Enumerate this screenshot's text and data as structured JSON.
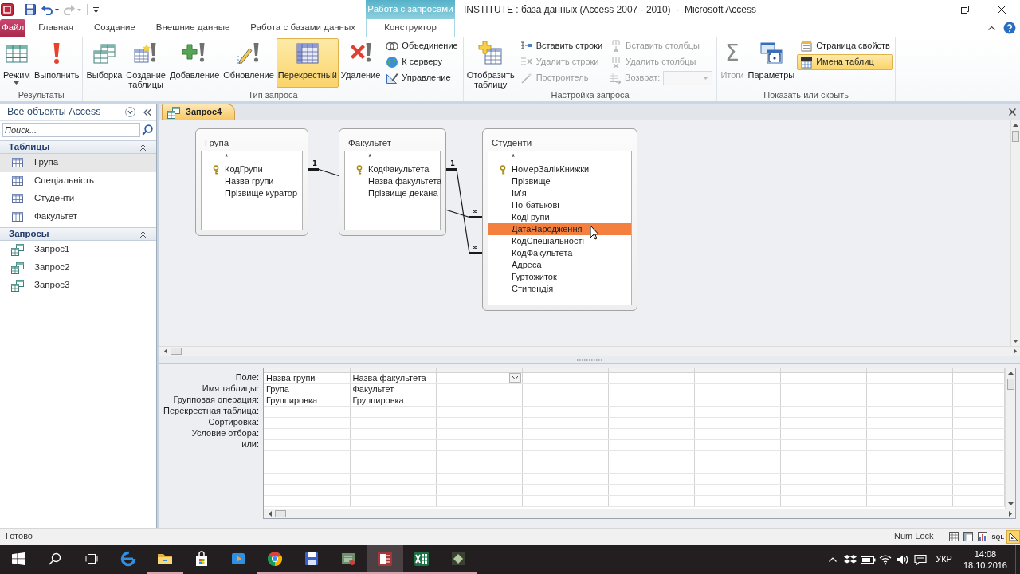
{
  "window": {
    "title": "INSTITUTE : база данных (Access 2007 - 2010)  -  Microsoft Access",
    "tab_group": "Работа с запросами"
  },
  "quick_access": [
    {
      "disabled": false
    },
    {
      "disabled": false
    },
    {
      "disabled": true
    }
  ],
  "ribbon_tabs": [
    {
      "label": "Файл",
      "kind": "file",
      "selected": false
    },
    {
      "label": "Главная",
      "kind": "plain",
      "selected": false
    },
    {
      "label": "Создание",
      "kind": "plain",
      "selected": false
    },
    {
      "label": "Внешние данные",
      "kind": "plain",
      "selected": false
    },
    {
      "label": "Работа с базами данных",
      "kind": "plain",
      "selected": false
    },
    {
      "label": "Конструктор",
      "kind": "context",
      "selected": true
    }
  ],
  "ribbon_groups": [
    {
      "label": "Результаты",
      "columns": [
        [
          {
            "kind": "large-menu",
            "label": "Режим",
            "disabled": false
          }
        ],
        [
          {
            "kind": "large",
            "label": "Выполнить",
            "disabled": false
          }
        ]
      ]
    },
    {
      "label": "Тип запроса",
      "columns": [
        [
          {
            "kind": "large",
            "label": "Выборка",
            "disabled": false,
            "selected": false
          }
        ],
        [
          {
            "kind": "large",
            "label": "Создание таблицы",
            "disabled": false,
            "selected": false
          }
        ],
        [
          {
            "kind": "large",
            "label": "Добавление",
            "disabled": false,
            "selected": false
          }
        ],
        [
          {
            "kind": "large",
            "label": "Обновление",
            "disabled": false,
            "selected": false
          }
        ],
        [
          {
            "kind": "large",
            "label": "Перекрестный",
            "disabled": false,
            "selected": true
          }
        ],
        [
          {
            "kind": "large",
            "label": "Удаление",
            "disabled": false,
            "selected": false
          }
        ],
        [
          {
            "kind": "small",
            "label": "Объединение",
            "disabled": false,
            "selected": false
          },
          {
            "kind": "small",
            "label": "К серверу",
            "disabled": false,
            "selected": false
          },
          {
            "kind": "small",
            "label": "Управление",
            "disabled": false,
            "selected": false
          }
        ]
      ]
    },
    {
      "label": "Настройка запроса",
      "columns": [
        [
          {
            "kind": "large",
            "label": "Отобразить таблицу",
            "disabled": false
          }
        ],
        [
          {
            "kind": "small",
            "label": "Вставить строки",
            "disabled": false
          },
          {
            "kind": "small",
            "label": "Удалить строки",
            "disabled": true
          },
          {
            "kind": "small",
            "label": "Построитель",
            "disabled": true
          }
        ],
        [
          {
            "kind": "small",
            "label": "Вставить столбцы",
            "disabled": true
          },
          {
            "kind": "small",
            "label": "Удалить столбцы",
            "disabled": true
          },
          {
            "kind": "combo",
            "label": "Возврат:",
            "disabled": true
          }
        ]
      ]
    },
    {
      "label": "Показать или скрыть",
      "columns": [
        [
          {
            "kind": "large",
            "label": "Итоги",
            "symbol": "Σ",
            "disabled": true
          }
        ],
        [
          {
            "kind": "large",
            "label": "Параметры",
            "disabled": false
          }
        ],
        [
          {
            "kind": "small",
            "label": "Страница свойств",
            "disabled": false,
            "on": false
          },
          {
            "kind": "small",
            "label": "Имена таблиц",
            "disabled": false,
            "on": true
          }
        ]
      ]
    }
  ],
  "nav_pane": {
    "title": "Все объекты Access",
    "search": {
      "placeholder": "Поиск..."
    },
    "groups": [
      {
        "label": "Таблицы",
        "expanded": true,
        "items": [
          {
            "label": "Група",
            "kind": "table",
            "selected": true
          },
          {
            "label": "Спеціальність",
            "kind": "table",
            "selected": false
          },
          {
            "label": "Студенти",
            "kind": "table",
            "selected": false
          },
          {
            "label": "Факультет",
            "kind": "table",
            "selected": false
          }
        ]
      },
      {
        "label": "Запросы",
        "expanded": true,
        "items": [
          {
            "label": "Запрос1",
            "kind": "query",
            "selected": false
          },
          {
            "label": "Запрос2",
            "kind": "query",
            "selected": false
          },
          {
            "label": "Запрос3",
            "kind": "query",
            "selected": false
          }
        ]
      }
    ]
  },
  "document_tabs": [
    {
      "label": "Запрос4",
      "selected": true
    }
  ],
  "query_design": {
    "tables": [
      {
        "title": "Група",
        "fields": [
          {
            "name": "*",
            "key": false,
            "selected": false
          },
          {
            "name": "КодГрупи",
            "key": true,
            "selected": false
          },
          {
            "name": "Назва групи",
            "key": false,
            "selected": false
          },
          {
            "name": "Прізвище куратор",
            "key": false,
            "selected": false
          }
        ]
      },
      {
        "title": "Факультет",
        "fields": [
          {
            "name": "*",
            "key": false,
            "selected": false
          },
          {
            "name": "КодФакультета",
            "key": true,
            "selected": false
          },
          {
            "name": "Назва факультета",
            "key": false,
            "selected": false
          },
          {
            "name": "Прізвище декана",
            "key": false,
            "selected": false
          }
        ]
      },
      {
        "title": "Студенти",
        "fields": [
          {
            "name": "*",
            "key": false,
            "selected": false
          },
          {
            "name": "НомерЗалікКнижки",
            "key": true,
            "selected": false
          },
          {
            "name": "Прізвище",
            "key": false,
            "selected": false
          },
          {
            "name": "Ім'я",
            "key": false,
            "selected": false
          },
          {
            "name": "По-батькові",
            "key": false,
            "selected": false
          },
          {
            "name": "КодГрупи",
            "key": false,
            "selected": false
          },
          {
            "name": "ДатаНародження",
            "key": false,
            "selected": true
          },
          {
            "name": "КодСпеціальності",
            "key": false,
            "selected": false
          },
          {
            "name": "КодФакультета",
            "key": false,
            "selected": false
          },
          {
            "name": "Адреса",
            "key": false,
            "selected": false
          },
          {
            "name": "Гуртожиток",
            "key": false,
            "selected": false
          },
          {
            "name": "Стипендія",
            "key": false,
            "selected": false
          }
        ]
      }
    ],
    "joins": [
      {
        "one": "1",
        "many": "∞"
      },
      {
        "one": "1",
        "many": "∞"
      }
    ]
  },
  "design_grid": {
    "row_labels": [
      "Поле:",
      "Имя таблицы:",
      "Групповая операция:",
      "Перекрестная таблица:",
      "Сортировка:",
      "Условие отбора:",
      "или:"
    ],
    "columns": [
      {
        "field": "Назва групи",
        "table": "Група",
        "total": "Группировка",
        "selected": false
      },
      {
        "field": "Назва факультета",
        "table": "Факультет",
        "total": "Группировка",
        "selected": false
      },
      {
        "selected": true
      }
    ]
  },
  "status_bar": {
    "text": "Готово",
    "indicator": "Num Lock",
    "views": [
      {
        "selected": false
      },
      {
        "selected": false
      },
      {
        "selected": false
      },
      {
        "label": "SQL",
        "selected": false
      },
      {
        "selected": true
      }
    ]
  },
  "taskbar": {
    "apps": [
      {
        "running": false,
        "active": false
      },
      {
        "running": true,
        "active": false
      },
      {
        "running": false,
        "active": false
      },
      {
        "running": false,
        "active": false
      },
      {
        "running": true,
        "active": false
      },
      {
        "running": true,
        "active": false
      },
      {
        "running": true,
        "active": false
      },
      {
        "running": true,
        "active": true
      },
      {
        "running": true,
        "active": false
      },
      {
        "running": true,
        "active": false
      }
    ],
    "tray": {
      "language": "УКР",
      "time": "14:08",
      "date": "18.10.2016"
    }
  }
}
